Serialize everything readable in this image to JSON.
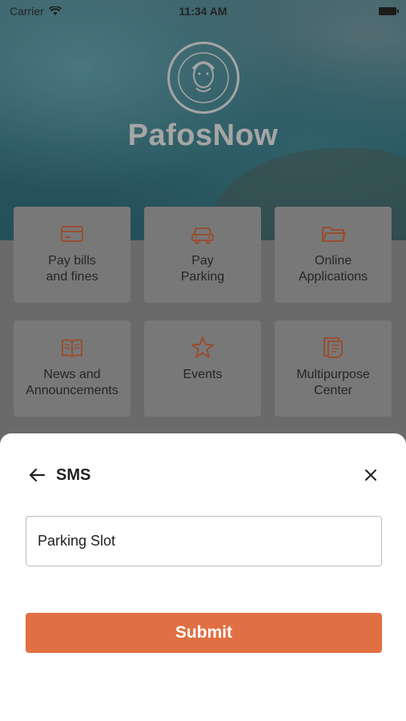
{
  "status_bar": {
    "carrier": "Carrier",
    "time": "11:34 AM"
  },
  "app": {
    "title": "PafosNow"
  },
  "tiles": [
    {
      "label": "Pay bills\nand fines",
      "icon": "credit-card-icon"
    },
    {
      "label": "Pay\nParking",
      "icon": "car-icon"
    },
    {
      "label": "Online\nApplications",
      "icon": "folder-icon"
    },
    {
      "label": "News and\nAnnouncements",
      "icon": "book-icon"
    },
    {
      "label": "Events",
      "icon": "star-icon"
    },
    {
      "label": "Multipurpose\nCenter",
      "icon": "documents-icon"
    }
  ],
  "sheet": {
    "title": "SMS",
    "input_value": "Parking Slot",
    "submit_label": "Submit"
  },
  "colors": {
    "accent": "#e07043",
    "icon_tint": "#b8542e"
  }
}
